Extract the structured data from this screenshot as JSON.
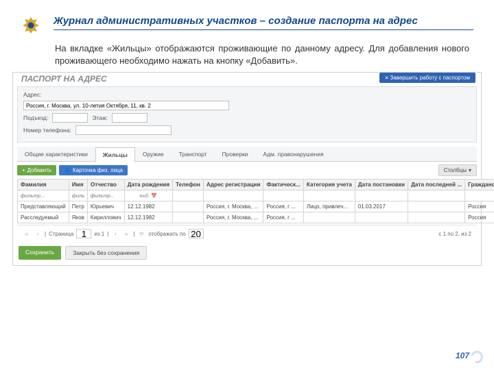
{
  "slide": {
    "title": "Журнал административных участков – создание паспорта на адрес",
    "desc": "На вкладке «Жильцы» отображаются проживающие по данному адресу. Для добавления нового проживающего необходимо нажать на кнопку «Добавить».",
    "page_number": "107"
  },
  "app": {
    "card_title": "ПАСПОРТ НА АДРЕС",
    "end_work": "Завершить работу с паспортом",
    "labels": {
      "address": "Адрес:",
      "entrance": "Подъезд:",
      "floor": "Этаж:",
      "phone": "Номер телефона:"
    },
    "values": {
      "address": "Россия, г. Москва, ул. 10-летия Октября, 11, кв. 2"
    },
    "tabs": [
      "Общие характеристики",
      "Жильцы",
      "Оружие",
      "Транспорт",
      "Проверки",
      "Адм. правонарушения"
    ],
    "active_tab_index": 1,
    "toolbar": {
      "add": "Добавить",
      "card": "Карточка физ. лица",
      "columns": "Столбцы"
    },
    "columns": [
      "Фамилия",
      "Имя",
      "Отчество",
      "Дата рождения",
      "Телефон",
      "Адрес регистрации",
      "Фактическ...",
      "Категория учета",
      "Дата постановки",
      "Дата последней ...",
      "Гражданство"
    ],
    "filter_placeholder": "фильтр...",
    "date_filter_label": "выб.",
    "rows": [
      {
        "c": [
          "Представляющий",
          "Петр",
          "Юрьевич",
          "12.12.1982",
          "",
          "Россия, г. Москва, ...",
          "Россия, г ...",
          "Лицо, привлеч...",
          "01.03.2017",
          "",
          "Россия"
        ]
      },
      {
        "c": [
          "Расследуемый",
          "Яков",
          "Кириллович",
          "12.12.1982",
          "",
          "Россия, г. Москва, ...",
          "Россия, г ...",
          "",
          "",
          "",
          "Россия"
        ]
      }
    ],
    "pager": {
      "page_label": "Страница",
      "page": "1",
      "of": "из 1",
      "display": "отображать по",
      "per_page": "20",
      "summary": "с 1 по 2, из 2"
    },
    "save": "Сохранить",
    "close": "Закрыть без сохранения"
  }
}
